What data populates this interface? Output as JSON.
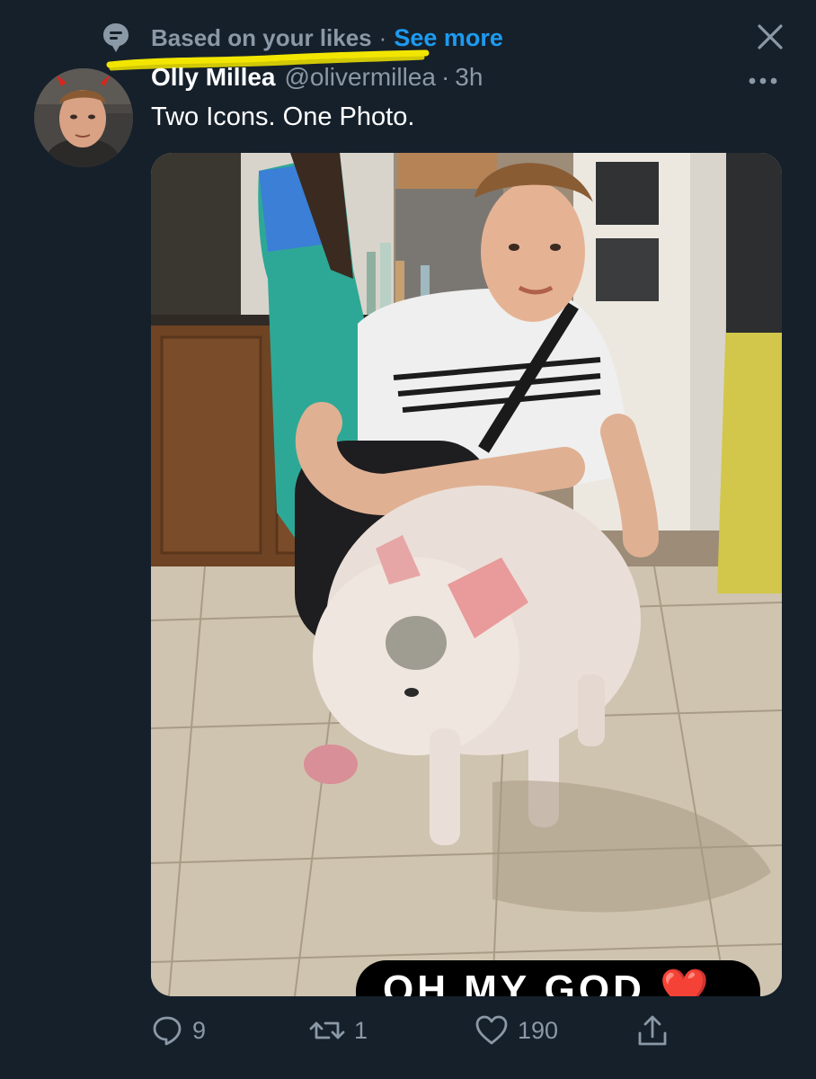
{
  "context": {
    "label": "Based on your likes",
    "separator": "·",
    "see_more": "See more"
  },
  "author": {
    "display_name": "Olly Millea",
    "handle": "@olivermillea",
    "separator": "·",
    "time": "3h"
  },
  "tweet": {
    "text": "Two Icons. One Photo.",
    "image_overlay_text": "OH MY GOD ❤️"
  },
  "actions": {
    "replies": "9",
    "retweets": "1",
    "likes": "190"
  },
  "icons": {
    "context": "topic-icon",
    "close": "close-icon",
    "more": "more-icon",
    "reply": "reply-icon",
    "retweet": "retweet-icon",
    "like": "heart-icon",
    "share": "share-icon"
  },
  "colors": {
    "background": "#15202b",
    "primary_text": "#ffffff",
    "secondary_text": "#8b98a5",
    "accent": "#1d9bf0",
    "highlighter": "#f2e600"
  }
}
